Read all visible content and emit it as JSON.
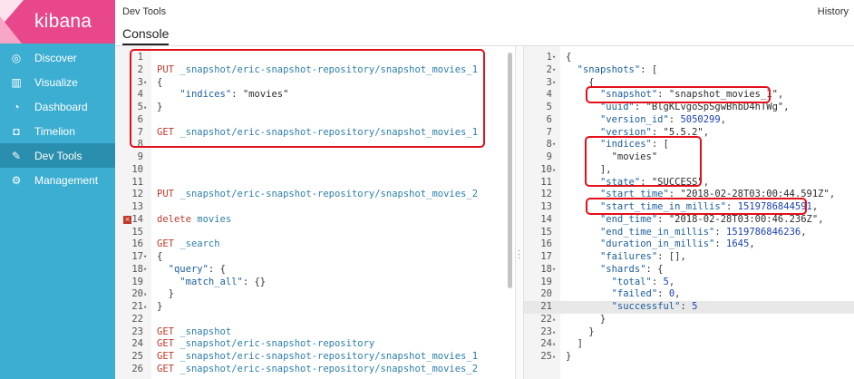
{
  "brand": {
    "name": "kibana"
  },
  "sidebar": {
    "items": [
      {
        "label": "Discover",
        "icon": "compass-icon"
      },
      {
        "label": "Visualize",
        "icon": "bar-chart-icon"
      },
      {
        "label": "Dashboard",
        "icon": "dashboard-icon"
      },
      {
        "label": "Timelion",
        "icon": "timelion-icon"
      },
      {
        "label": "Dev Tools",
        "icon": "wrench-icon",
        "active": true
      },
      {
        "label": "Management",
        "icon": "gear-icon"
      }
    ]
  },
  "header": {
    "breadcrumb": "Dev Tools",
    "history": "History",
    "tab": "Console"
  },
  "request_lines": [
    {
      "n": "1",
      "parts": []
    },
    {
      "n": "2",
      "parts": [
        [
          "kw",
          "PUT "
        ],
        [
          "url",
          "_snapshot/eric-snapshot-repository/snapshot_movies_1"
        ]
      ]
    },
    {
      "n": "3",
      "fold": "▾",
      "parts": [
        [
          "plain",
          "{"
        ]
      ]
    },
    {
      "n": "4",
      "parts": [
        [
          "plain",
          "    "
        ],
        [
          "key",
          "\"indices\""
        ],
        [
          "plain",
          ": "
        ],
        [
          "str",
          "\"movies\""
        ]
      ]
    },
    {
      "n": "5",
      "fold": "▴",
      "parts": [
        [
          "plain",
          "}"
        ]
      ]
    },
    {
      "n": "6",
      "parts": []
    },
    {
      "n": "7",
      "parts": [
        [
          "kw",
          "GET "
        ],
        [
          "url",
          "_snapshot/eric-snapshot-repository/snapshot_movies_1"
        ]
      ]
    },
    {
      "n": "8",
      "parts": []
    },
    {
      "n": "9",
      "parts": []
    },
    {
      "n": "10",
      "parts": []
    },
    {
      "n": "11",
      "parts": []
    },
    {
      "n": "12",
      "parts": [
        [
          "kw",
          "PUT "
        ],
        [
          "url",
          "_snapshot/eric-snapshot-repository/snapshot_movies_2"
        ]
      ]
    },
    {
      "n": "13",
      "parts": []
    },
    {
      "n": "14",
      "error": true,
      "parts": [
        [
          "kw",
          "delete "
        ],
        [
          "url",
          "movies"
        ]
      ]
    },
    {
      "n": "15",
      "parts": []
    },
    {
      "n": "16",
      "parts": [
        [
          "kw",
          "GET "
        ],
        [
          "url",
          "_search"
        ]
      ]
    },
    {
      "n": "17",
      "fold": "▾",
      "parts": [
        [
          "plain",
          "{"
        ]
      ]
    },
    {
      "n": "18",
      "fold": "▾",
      "parts": [
        [
          "plain",
          "  "
        ],
        [
          "key",
          "\"query\""
        ],
        [
          "plain",
          ": {"
        ]
      ]
    },
    {
      "n": "19",
      "parts": [
        [
          "plain",
          "    "
        ],
        [
          "key",
          "\"match_all\""
        ],
        [
          "plain",
          ": {}"
        ]
      ]
    },
    {
      "n": "20",
      "fold": "▴",
      "parts": [
        [
          "plain",
          "  }"
        ]
      ]
    },
    {
      "n": "21",
      "fold": "▴",
      "parts": [
        [
          "plain",
          "}"
        ]
      ]
    },
    {
      "n": "22",
      "parts": []
    },
    {
      "n": "23",
      "parts": [
        [
          "kw",
          "GET "
        ],
        [
          "url",
          "_snapshot"
        ]
      ]
    },
    {
      "n": "24",
      "parts": [
        [
          "kw",
          "GET "
        ],
        [
          "url",
          "_snapshot/eric-snapshot-repository"
        ]
      ]
    },
    {
      "n": "25",
      "parts": [
        [
          "kw",
          "GET "
        ],
        [
          "url",
          "_snapshot/eric-snapshot-repository/snapshot_movies_1"
        ]
      ]
    },
    {
      "n": "26",
      "parts": [
        [
          "kw",
          "GET "
        ],
        [
          "url",
          "_snapshot/eric-snapshot-repository/snapshot_movies_2"
        ]
      ]
    }
  ],
  "response_lines": [
    {
      "n": "1",
      "fold": "▾",
      "parts": [
        [
          "plain",
          "{"
        ]
      ]
    },
    {
      "n": "2",
      "fold": "▾",
      "parts": [
        [
          "plain",
          "  "
        ],
        [
          "key",
          "\"snapshots\""
        ],
        [
          "plain",
          ": ["
        ]
      ]
    },
    {
      "n": "3",
      "fold": "▾",
      "parts": [
        [
          "plain",
          "    {"
        ]
      ]
    },
    {
      "n": "4",
      "parts": [
        [
          "plain",
          "      "
        ],
        [
          "key",
          "\"snapshot\""
        ],
        [
          "plain",
          ": "
        ],
        [
          "str",
          "\"snapshot_movies_1\""
        ],
        [
          "plain",
          ","
        ]
      ]
    },
    {
      "n": "5",
      "parts": [
        [
          "plain",
          "      "
        ],
        [
          "key",
          "\"uuid\""
        ],
        [
          "plain",
          ": "
        ],
        [
          "str",
          "\"BlgKLvgoSpSgwBhbD4hTWg\""
        ],
        [
          "plain",
          ","
        ]
      ]
    },
    {
      "n": "6",
      "parts": [
        [
          "plain",
          "      "
        ],
        [
          "key",
          "\"version_id\""
        ],
        [
          "plain",
          ": "
        ],
        [
          "num",
          "5050299"
        ],
        [
          "plain",
          ","
        ]
      ]
    },
    {
      "n": "7",
      "parts": [
        [
          "plain",
          "      "
        ],
        [
          "key",
          "\"version\""
        ],
        [
          "plain",
          ": "
        ],
        [
          "str",
          "\"5.5.2\""
        ],
        [
          "plain",
          ","
        ]
      ]
    },
    {
      "n": "8",
      "fold": "▾",
      "parts": [
        [
          "plain",
          "      "
        ],
        [
          "key",
          "\"indices\""
        ],
        [
          "plain",
          ": ["
        ]
      ]
    },
    {
      "n": "9",
      "parts": [
        [
          "plain",
          "        "
        ],
        [
          "str",
          "\"movies\""
        ]
      ]
    },
    {
      "n": "10",
      "fold": "▴",
      "parts": [
        [
          "plain",
          "      ],"
        ]
      ]
    },
    {
      "n": "11",
      "parts": [
        [
          "plain",
          "      "
        ],
        [
          "key",
          "\"state\""
        ],
        [
          "plain",
          ": "
        ],
        [
          "str",
          "\"SUCCESS\""
        ],
        [
          "plain",
          ","
        ]
      ]
    },
    {
      "n": "12",
      "parts": [
        [
          "plain",
          "      "
        ],
        [
          "key",
          "\"start_time\""
        ],
        [
          "plain",
          ": "
        ],
        [
          "str",
          "\"2018-02-28T03:00:44.591Z\""
        ],
        [
          "plain",
          ","
        ]
      ]
    },
    {
      "n": "13",
      "parts": [
        [
          "plain",
          "      "
        ],
        [
          "key",
          "\"start_time_in_millis\""
        ],
        [
          "plain",
          ": "
        ],
        [
          "num",
          "1519786844591"
        ],
        [
          "plain",
          ","
        ]
      ]
    },
    {
      "n": "14",
      "parts": [
        [
          "plain",
          "      "
        ],
        [
          "key",
          "\"end_time\""
        ],
        [
          "plain",
          ": "
        ],
        [
          "str",
          "\"2018-02-28T03:00:46.236Z\""
        ],
        [
          "plain",
          ","
        ]
      ]
    },
    {
      "n": "15",
      "parts": [
        [
          "plain",
          "      "
        ],
        [
          "key",
          "\"end_time_in_millis\""
        ],
        [
          "plain",
          ": "
        ],
        [
          "num",
          "1519786846236"
        ],
        [
          "plain",
          ","
        ]
      ]
    },
    {
      "n": "16",
      "parts": [
        [
          "plain",
          "      "
        ],
        [
          "key",
          "\"duration_in_millis\""
        ],
        [
          "plain",
          ": "
        ],
        [
          "num",
          "1645"
        ],
        [
          "plain",
          ","
        ]
      ]
    },
    {
      "n": "17",
      "parts": [
        [
          "plain",
          "      "
        ],
        [
          "key",
          "\"failures\""
        ],
        [
          "plain",
          ": [],"
        ]
      ]
    },
    {
      "n": "18",
      "fold": "▾",
      "parts": [
        [
          "plain",
          "      "
        ],
        [
          "key",
          "\"shards\""
        ],
        [
          "plain",
          ": {"
        ]
      ]
    },
    {
      "n": "19",
      "parts": [
        [
          "plain",
          "        "
        ],
        [
          "key",
          "\"total\""
        ],
        [
          "plain",
          ": "
        ],
        [
          "num",
          "5"
        ],
        [
          "plain",
          ","
        ]
      ]
    },
    {
      "n": "20",
      "parts": [
        [
          "plain",
          "        "
        ],
        [
          "key",
          "\"failed\""
        ],
        [
          "plain",
          ": "
        ],
        [
          "num",
          "0"
        ],
        [
          "plain",
          ","
        ]
      ]
    },
    {
      "n": "21",
      "highlight": true,
      "parts": [
        [
          "plain",
          "        "
        ],
        [
          "key",
          "\"successful\""
        ],
        [
          "plain",
          ": "
        ],
        [
          "num",
          "5"
        ]
      ]
    },
    {
      "n": "22",
      "fold": "▴",
      "parts": [
        [
          "plain",
          "      }"
        ]
      ]
    },
    {
      "n": "23",
      "fold": "▴",
      "parts": [
        [
          "plain",
          "    }"
        ]
      ]
    },
    {
      "n": "24",
      "fold": "▴",
      "parts": [
        [
          "plain",
          "  ]"
        ]
      ]
    },
    {
      "n": "25",
      "fold": "▴",
      "parts": [
        [
          "plain",
          "}"
        ]
      ]
    }
  ]
}
